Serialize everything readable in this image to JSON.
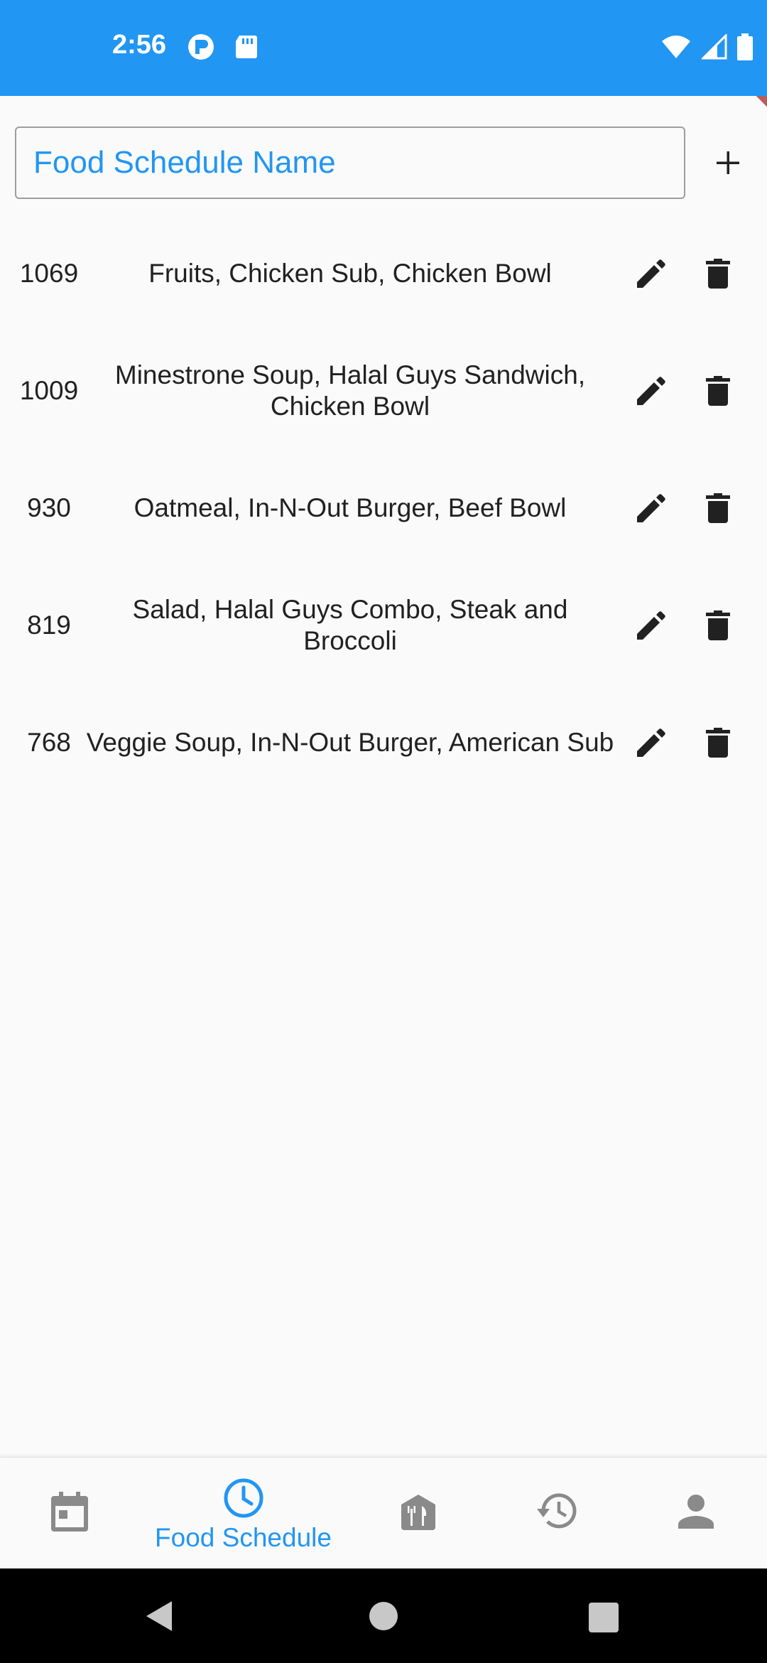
{
  "status_bar": {
    "time": "2:56",
    "background": "#2196f3"
  },
  "form": {
    "name_placeholder": "Food Schedule Name",
    "add_icon": "plus-icon"
  },
  "schedules": [
    {
      "calories": "1069",
      "meals": "Fruits, Chicken Sub, Chicken Bowl"
    },
    {
      "calories": "1009",
      "meals": "Minestrone Soup, Halal Guys Sandwich, Chicken Bowl"
    },
    {
      "calories": "930",
      "meals": "Oatmeal, In-N-Out Burger, Beef Bowl"
    },
    {
      "calories": "819",
      "meals": "Salad, Halal Guys Combo, Steak and Broccoli"
    },
    {
      "calories": "768",
      "meals": "Veggie Soup, In-N-Out Burger, American Sub"
    }
  ],
  "row_actions": {
    "edit_icon": "pencil-icon",
    "delete_icon": "trash-icon"
  },
  "bottom_nav": {
    "active_label": "Food Schedule",
    "items": [
      {
        "icon": "calendar-icon"
      },
      {
        "icon": "clock-icon",
        "label": "Food Schedule",
        "active": true
      },
      {
        "icon": "restaurant-icon"
      },
      {
        "icon": "history-icon"
      },
      {
        "icon": "person-icon"
      }
    ],
    "active_color": "#2196f3",
    "inactive_color": "#8a8a8a"
  }
}
